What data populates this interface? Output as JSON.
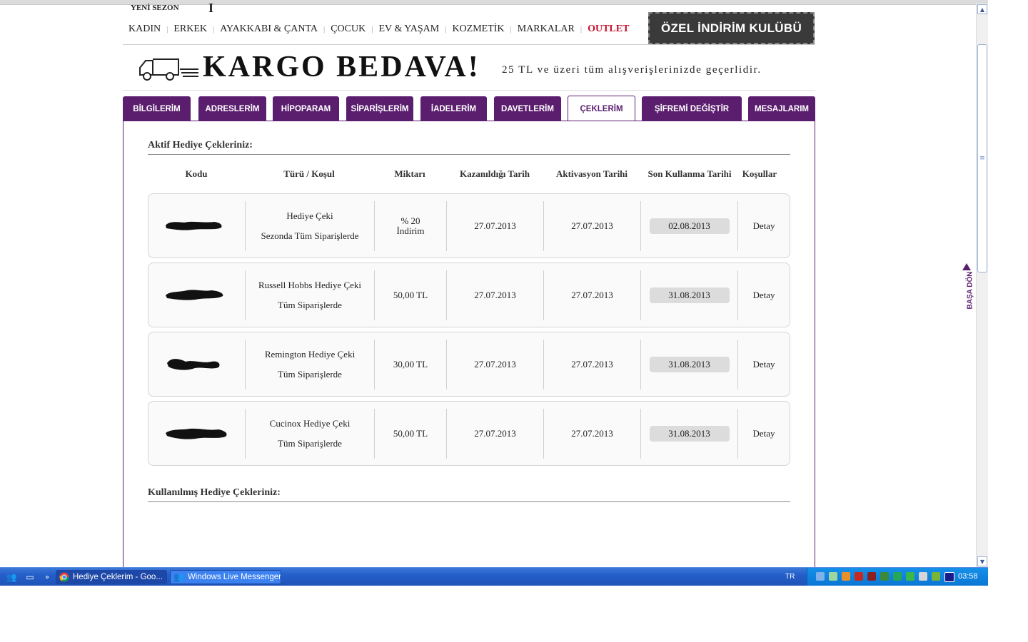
{
  "header": {
    "season_label": "YENİ SEZON",
    "logo_fragment": "I",
    "nav": [
      {
        "label": "KADIN",
        "outlet": false
      },
      {
        "label": "ERKEK",
        "outlet": false
      },
      {
        "label": "AYAKKABI & ÇANTA",
        "outlet": false
      },
      {
        "label": "ÇOCUK",
        "outlet": false
      },
      {
        "label": "EV & YAŞAM",
        "outlet": false
      },
      {
        "label": "KOZMETİK",
        "outlet": false
      },
      {
        "label": "MARKALAR",
        "outlet": false
      },
      {
        "label": "OUTLET",
        "outlet": true
      }
    ],
    "club_banner": "ÖZEL İNDİRİM KULÜBÜ",
    "promo_title": "KARGO BEDAVA!",
    "promo_subtitle": "25 TL ve üzeri tüm alışverişlerinizde geçerlidir."
  },
  "tabs": [
    {
      "label": "BİLGİLERİM",
      "active": false
    },
    {
      "label": "ADRESLERİM",
      "active": false
    },
    {
      "label": "HİPOPARAM",
      "active": false
    },
    {
      "label": "SİPARİŞLERİM",
      "active": false
    },
    {
      "label": "İADELERİM",
      "active": false
    },
    {
      "label": "DAVETLERİM",
      "active": false
    },
    {
      "label": "ÇEKLERİM",
      "active": true
    },
    {
      "label": "ŞİFREMİ DEĞİŞTİR",
      "active": false
    },
    {
      "label": "MESAJLARIM",
      "active": false
    }
  ],
  "active_section": {
    "title": "Aktif Hediye Çekleriniz:",
    "columns": [
      "Kodu",
      "Türü / Koşul",
      "Miktarı",
      "Kazanıldığı Tarih",
      "Aktivasyon Tarihi",
      "Son Kullanma Tarihi",
      "Koşullar"
    ],
    "rows": [
      {
        "type_line1": "Hediye Çeki",
        "type_line2": "Sezonda Tüm Siparişlerde",
        "amount_line1": "% 20",
        "amount_line2": "İndirim",
        "earned": "27.07.2013",
        "activated": "27.07.2013",
        "expires": "02.08.2013",
        "conditions": "Detay"
      },
      {
        "type_line1": "Russell Hobbs Hediye Çeki",
        "type_line2": "Tüm Siparişlerde",
        "amount_line1": "50,00 TL",
        "amount_line2": "",
        "earned": "27.07.2013",
        "activated": "27.07.2013",
        "expires": "31.08.2013",
        "conditions": "Detay"
      },
      {
        "type_line1": "Remington Hediye Çeki",
        "type_line2": "Tüm Siparişlerde",
        "amount_line1": "30,00 TL",
        "amount_line2": "",
        "earned": "27.07.2013",
        "activated": "27.07.2013",
        "expires": "31.08.2013",
        "conditions": "Detay"
      },
      {
        "type_line1": "Cucinox Hediye Çeki",
        "type_line2": "Tüm Siparişlerde",
        "amount_line1": "50,00 TL",
        "amount_line2": "",
        "earned": "27.07.2013",
        "activated": "27.07.2013",
        "expires": "31.08.2013",
        "conditions": "Detay"
      }
    ]
  },
  "used_section": {
    "title": "Kullanılmış Hediye Çekleriniz:"
  },
  "side": {
    "back_to_top": "BAŞA DÖN"
  },
  "taskbar": {
    "windows": [
      {
        "label": "Hediye Çeklerim - Goo...",
        "active": true
      },
      {
        "label": "Windows Live Messenger",
        "active": false
      }
    ],
    "language": "TR",
    "clock": "03:58"
  },
  "colors": {
    "brand_purple": "#5b1e6e",
    "outlet_red": "#c8102e",
    "taskbar_blue": "#245ec9"
  }
}
